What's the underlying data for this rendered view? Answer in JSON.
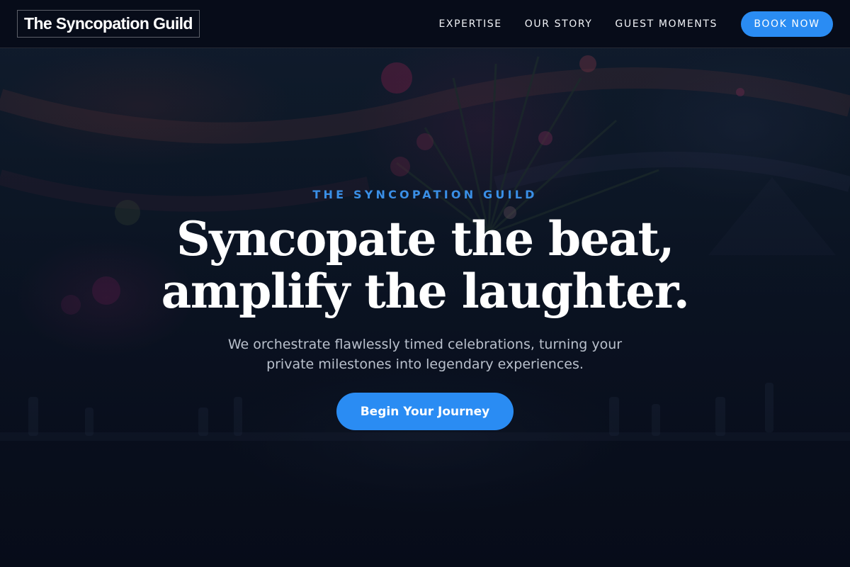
{
  "header": {
    "logo_text": "The Syncopation Guild",
    "nav": [
      {
        "label": "EXPERTISE"
      },
      {
        "label": "OUR STORY"
      },
      {
        "label": "GUEST MOMENTS"
      }
    ],
    "book_button_label": "BOOK NOW"
  },
  "hero": {
    "eyebrow": "THE SYNCOPATION GUILD",
    "headline_line1": "Syncopate the beat,",
    "headline_line2": "amplify the laughter.",
    "subhead": "We orchestrate flawlessly timed celebrations, turning your private milestones into legendary experiences.",
    "cta_label": "Begin Your Journey"
  },
  "colors": {
    "accent": "#2a8cf3",
    "eyebrow": "#3a8fe6",
    "header_bg": "#060b18",
    "page_bg": "#0a1020"
  }
}
